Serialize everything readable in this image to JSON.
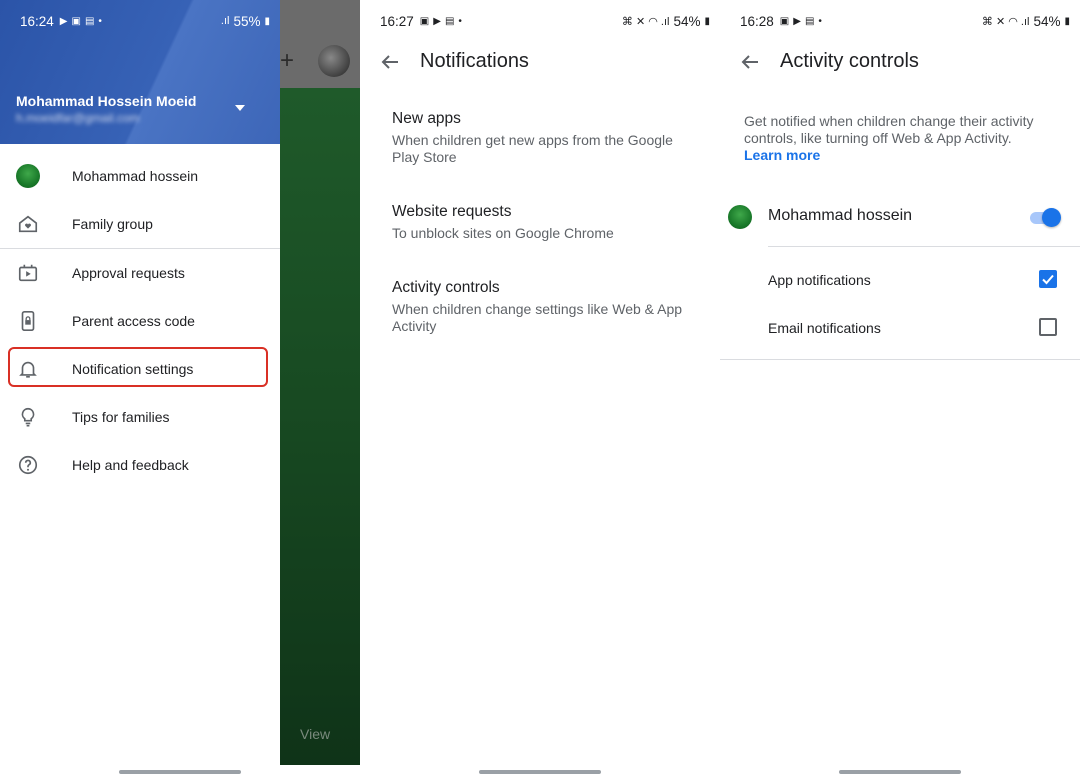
{
  "panel1": {
    "status": {
      "time": "16:24",
      "battery": "55%"
    },
    "account": {
      "name": "Mohammad Hossein Moeid",
      "email": "h.moeidfar@gmail.com"
    },
    "menu": [
      {
        "label": "Mohammad hossein",
        "icon": "child-avatar-icon"
      },
      {
        "label": "Family group",
        "icon": "family-home-icon"
      },
      {
        "label": "Approval requests",
        "icon": "approval-icon"
      },
      {
        "label": "Parent access code",
        "icon": "phone-lock-icon"
      },
      {
        "label": "Notification settings",
        "icon": "bell-icon"
      },
      {
        "label": "Tips for families",
        "icon": "lightbulb-icon"
      },
      {
        "label": "Help and feedback",
        "icon": "help-icon"
      }
    ],
    "background_view_label": "View"
  },
  "panel2": {
    "status": {
      "time": "16:27",
      "battery": "54%"
    },
    "title": "Notifications",
    "items": [
      {
        "title": "New apps",
        "desc": "When children get new apps from the Google Play Store"
      },
      {
        "title": "Website requests",
        "desc": "To unblock sites on Google Chrome"
      },
      {
        "title": "Activity controls",
        "desc": "When children change settings like Web & App Activity"
      }
    ]
  },
  "panel3": {
    "status": {
      "time": "16:28",
      "battery": "54%"
    },
    "title": "Activity controls",
    "description": "Get notified when children change their activity controls, like turning off Web & App Activity.",
    "learn_more": "Learn more",
    "child_name": "Mohammad hossein",
    "child_toggle_on": true,
    "options": [
      {
        "label": "App notifications",
        "checked": true
      },
      {
        "label": "Email notifications",
        "checked": false
      }
    ]
  },
  "colors": {
    "accent": "#1a73e8",
    "header_blue": "#3762b6",
    "highlight_red": "#d93025"
  }
}
